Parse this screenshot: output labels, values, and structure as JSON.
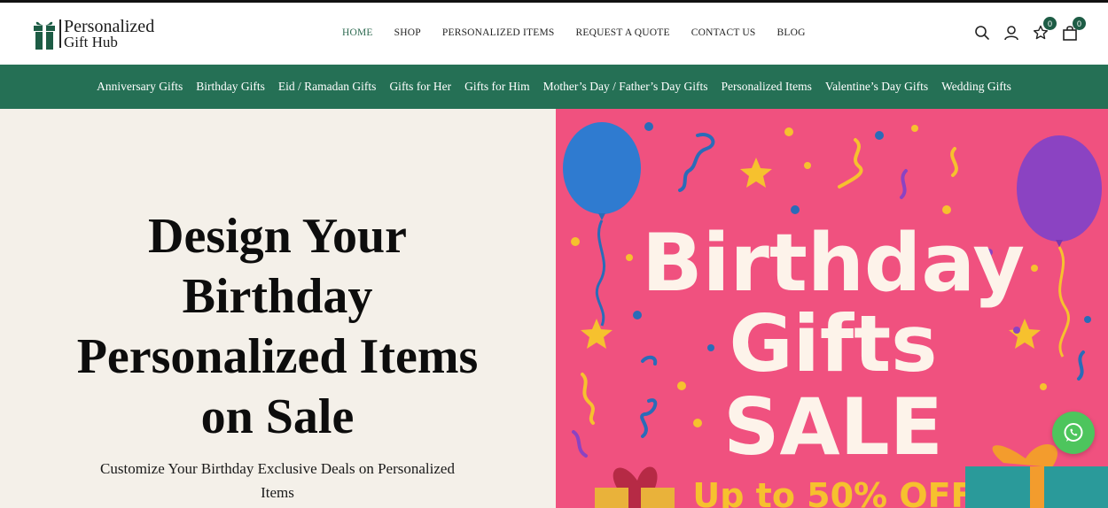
{
  "brand": {
    "line1": "Personalized",
    "line2": "Gift Hub",
    "accent": "#1d5c45"
  },
  "nav": {
    "items": [
      {
        "label": "HOME",
        "active": true
      },
      {
        "label": "SHOP"
      },
      {
        "label": "PERSONALIZED ITEMS"
      },
      {
        "label": "REQUEST A QUOTE"
      },
      {
        "label": "CONTACT US"
      },
      {
        "label": "BLOG"
      }
    ]
  },
  "header_icons": {
    "search": "search-icon",
    "account": "user-icon",
    "wishlist": {
      "icon": "star-icon",
      "count": "0"
    },
    "cart": {
      "icon": "bag-icon",
      "count": "0"
    }
  },
  "categories": [
    "Anniversary Gifts",
    "Birthday Gifts",
    "Eid / Ramadan Gifts",
    "Gifts for Her",
    "Gifts for Him",
    "Mother’s Day / Father’s Day Gifts",
    "Personalized Items",
    "Valentine’s Day Gifts",
    "Wedding Gifts"
  ],
  "hero": {
    "title": "Design Your Birthday Personalized Items on Sale",
    "subtitle": "Customize Your Birthday Exclusive Deals on Personalized Items",
    "banner": {
      "line1": "Birthday",
      "line2": "Gifts",
      "line3": "SALE",
      "promo": "Up to 50% OFF",
      "bg": "#f0517f"
    }
  },
  "whatsapp_icon": "whatsapp-icon"
}
